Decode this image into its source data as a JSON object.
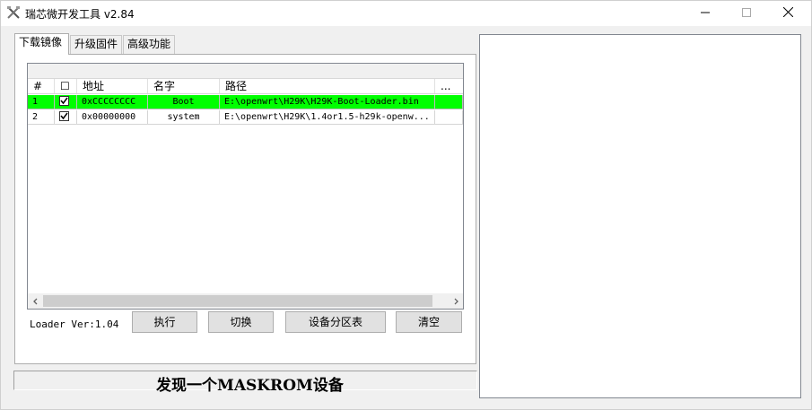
{
  "window": {
    "title": "瑞芯微开发工具 v2.84",
    "icon": "crossed-tools-icon",
    "controls": {
      "minimize": "minimize-icon",
      "maximize": "maximize-icon",
      "close": "close-icon"
    }
  },
  "tabs": [
    {
      "label": "下载镜像",
      "active": true
    },
    {
      "label": "升级固件",
      "active": false
    },
    {
      "label": "高级功能",
      "active": false
    }
  ],
  "table": {
    "columns": [
      "#",
      "☐",
      "地址",
      "名字",
      "路径",
      "..."
    ],
    "rows": [
      {
        "num": "1",
        "checked": true,
        "address": "0xCCCCCCCC",
        "name": "Boot",
        "path": "E:\\openwrt\\H29K\\H29K-Boot-Loader.bin",
        "highlight": "#00ff00"
      },
      {
        "num": "2",
        "checked": true,
        "address": "0x00000000",
        "name": "system",
        "path": "E:\\openwrt\\H29K\\1.4or1.5-h29k-openw...",
        "highlight": "#ffffff"
      }
    ]
  },
  "loader_version": "Loader Ver:1.04",
  "buttons": {
    "execute": "执行",
    "switch": "切换",
    "partition_table": "设备分区表",
    "clear": "清空"
  },
  "status": "发现一个MASKROM设备",
  "colors": {
    "highlight_row": "#00ff00",
    "window_bg": "#f0f0f0",
    "panel_bg": "#ffffff"
  }
}
